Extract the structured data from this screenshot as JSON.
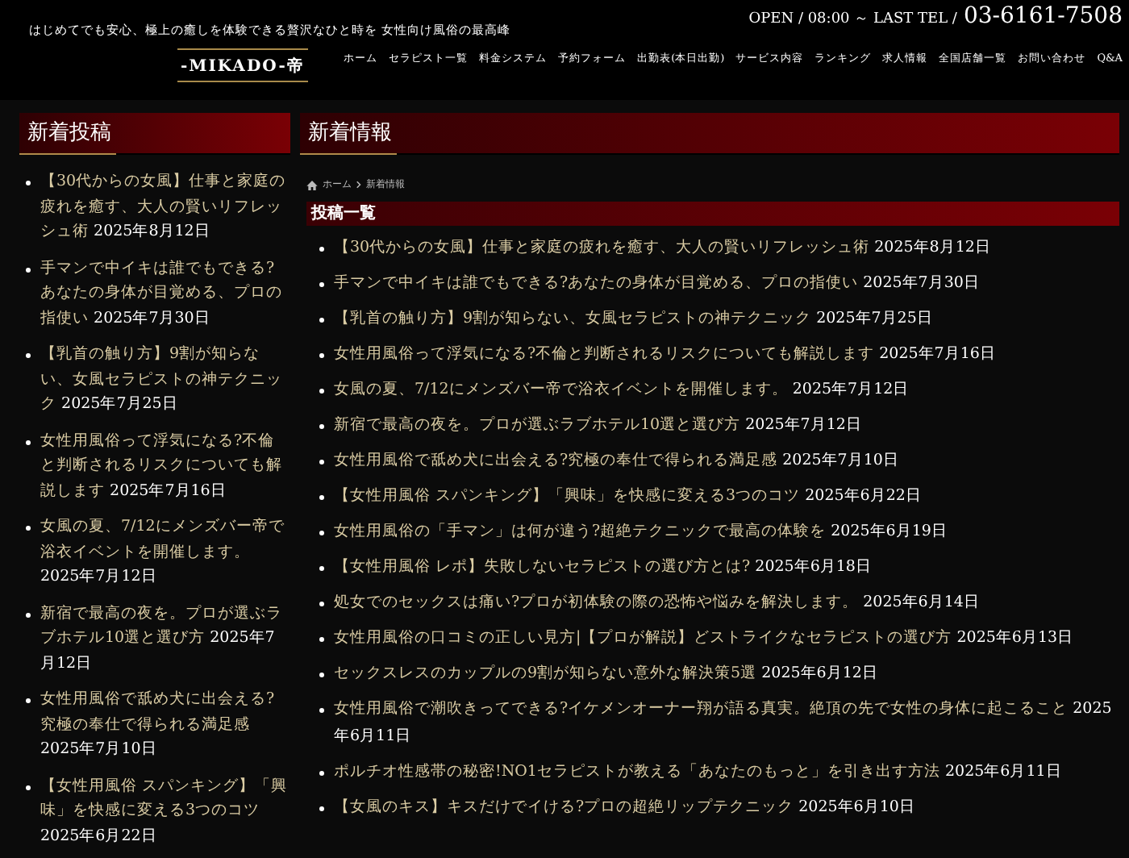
{
  "header": {
    "tagline": "はじめてでも安心、極上の癒しを体験できる贅沢なひと時を 女性向け風俗の最高峰",
    "hours": "OPEN / 08:00 ～ LAST TEL /",
    "phone": "03-6161-7508",
    "logo": "-MIKADO-帝",
    "nav": [
      "ホーム",
      "セラピスト一覧",
      "料金システム",
      "予約フォーム",
      "出勤表(本日出勤)",
      "サービス内容",
      "ランキング",
      "求人情報",
      "全国店舗一覧",
      "お問い合わせ",
      "Q&A"
    ]
  },
  "sidebar": {
    "title": "新着投稿",
    "posts": [
      {
        "title": "【30代からの女風】仕事と家庭の疲れを癒す、大人の賢いリフレッシュ術",
        "date": "2025年8月12日"
      },
      {
        "title": "手マンで中イキは誰でもできる?あなたの身体が目覚める、プロの指使い",
        "date": "2025年7月30日"
      },
      {
        "title": "【乳首の触り方】9割が知らない、女風セラピストの神テクニック",
        "date": "2025年7月25日"
      },
      {
        "title": "女性用風俗って浮気になる?不倫と判断されるリスクについても解説します",
        "date": "2025年7月16日"
      },
      {
        "title": "女風の夏、7/12にメンズバー帝で浴衣イベントを開催します。",
        "date": "2025年7月12日"
      },
      {
        "title": "新宿で最高の夜を。プロが選ぶラブホテル10選と選び方",
        "date": "2025年7月12日"
      },
      {
        "title": "女性用風俗で舐め犬に出会える?究極の奉仕で得られる満足感",
        "date": "2025年7月10日"
      },
      {
        "title": "【女性用風俗 スパンキング】「興味」を快感に変える3つのコツ",
        "date": "2025年6月22日"
      }
    ]
  },
  "main": {
    "title": "新着情報",
    "breadcrumb": [
      "ホーム",
      "新着情報"
    ],
    "section_title": "投稿一覧",
    "posts": [
      {
        "title": "【30代からの女風】仕事と家庭の疲れを癒す、大人の賢いリフレッシュ術",
        "date": "2025年8月12日"
      },
      {
        "title": "手マンで中イキは誰でもできる?あなたの身体が目覚める、プロの指使い",
        "date": "2025年7月30日"
      },
      {
        "title": "【乳首の触り方】9割が知らない、女風セラピストの神テクニック",
        "date": "2025年7月25日"
      },
      {
        "title": "女性用風俗って浮気になる?不倫と判断されるリスクについても解説します",
        "date": "2025年7月16日"
      },
      {
        "title": "女風の夏、7/12にメンズバー帝で浴衣イベントを開催します。",
        "date": "2025年7月12日"
      },
      {
        "title": "新宿で最高の夜を。プロが選ぶラブホテル10選と選び方",
        "date": "2025年7月12日"
      },
      {
        "title": "女性用風俗で舐め犬に出会える?究極の奉仕で得られる満足感",
        "date": "2025年7月10日"
      },
      {
        "title": "【女性用風俗 スパンキング】「興味」を快感に変える3つのコツ",
        "date": "2025年6月22日"
      },
      {
        "title": "女性用風俗の「手マン」は何が違う?超絶テクニックで最高の体験を",
        "date": "2025年6月19日"
      },
      {
        "title": "【女性用風俗 レポ】失敗しないセラピストの選び方とは?",
        "date": "2025年6月18日"
      },
      {
        "title": "処女でのセックスは痛い?プロが初体験の際の恐怖や悩みを解決します。",
        "date": "2025年6月14日"
      },
      {
        "title": "女性用風俗の口コミの正しい見方|【プロが解説】どストライクなセラピストの選び方",
        "date": "2025年6月13日"
      },
      {
        "title": "セックスレスのカップルの9割が知らない意外な解決策5選",
        "date": "2025年6月12日"
      },
      {
        "title": "女性用風俗で潮吹きってできる?イケメンオーナー翔が語る真実。絶頂の先で女性の身体に起こること",
        "date": "2025年6月11日"
      },
      {
        "title": "ポルチオ性感帯の秘密!NO1セラピストが教える「あなたのもっと」を引き出す方法",
        "date": "2025年6月11日"
      },
      {
        "title": "【女風のキス】キスだけでイける?プロの超絶リップテクニック",
        "date": "2025年6月10日"
      }
    ]
  }
}
